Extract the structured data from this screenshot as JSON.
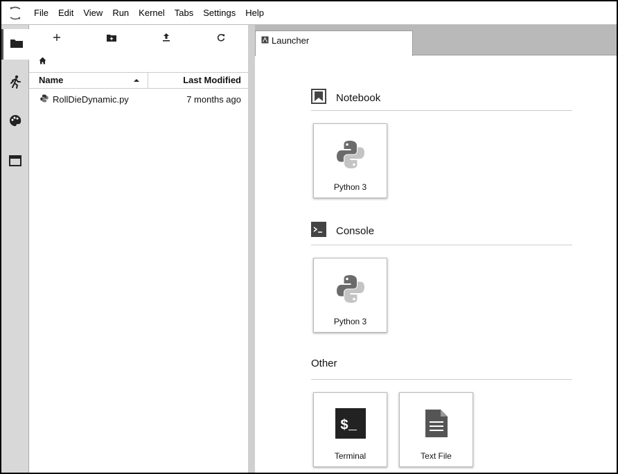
{
  "menu": [
    "File",
    "Edit",
    "View",
    "Run",
    "Kernel",
    "Tabs",
    "Settings",
    "Help"
  ],
  "activity_icons": [
    "folder-icon",
    "running-icon",
    "palette-icon",
    "tabs-icon"
  ],
  "filebrowser": {
    "toolbar_icons": [
      "new-launcher-icon",
      "new-folder-icon",
      "upload-icon",
      "refresh-icon"
    ],
    "columns": {
      "name": "Name",
      "modified": "Last Modified"
    },
    "files": [
      {
        "name": "RollDieDynamic.py",
        "modified": "7 months ago"
      }
    ]
  },
  "tab": {
    "label": "Launcher"
  },
  "launcher": {
    "notebook": {
      "title": "Notebook",
      "items": [
        "Python 3"
      ]
    },
    "console": {
      "title": "Console",
      "items": [
        "Python 3"
      ]
    },
    "other": {
      "title": "Other",
      "items": [
        "Terminal",
        "Text File"
      ]
    }
  }
}
